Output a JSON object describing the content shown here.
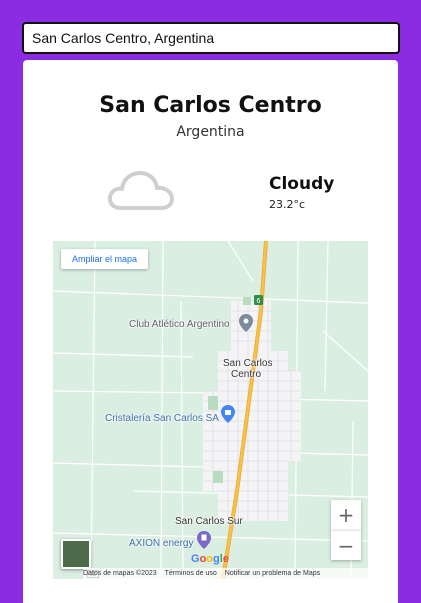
{
  "search": {
    "value": "San Carlos Centro, Argentina"
  },
  "weather": {
    "city": "San Carlos Centro",
    "country": "Argentina",
    "condition": "Cloudy",
    "temperature": "23.2°c",
    "icon": "cloud-icon"
  },
  "map": {
    "expand_label": "Ampliar el mapa",
    "places": {
      "club": "Club Atlético Argentino",
      "center_line1": "San Carlos",
      "center_line2": "Centro",
      "cristaleria": "Cristalería San Carlos SA",
      "sur": "San Carlos Sur",
      "axion": "AXION energy"
    },
    "route_badge": "6",
    "zoom_in": "+",
    "zoom_out": "−",
    "logo": "Google",
    "footer": {
      "data": "Datos de mapas ©2023",
      "terms": "Términos de uso",
      "report": "Notificar un problema de Maps"
    }
  },
  "colors": {
    "background": "#8b2be2",
    "map_land": "#dbeee2",
    "main_road": "#f6c344"
  }
}
